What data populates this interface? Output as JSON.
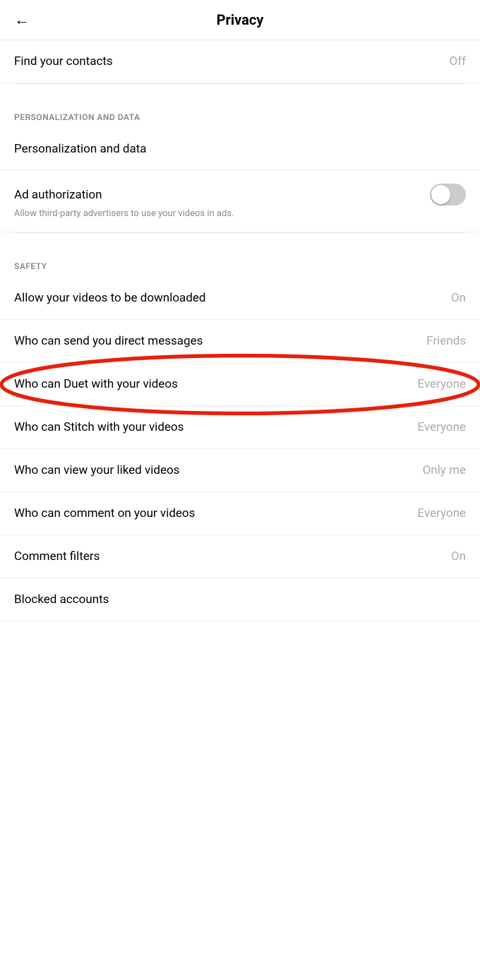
{
  "header": {
    "title": "Privacy",
    "back_label": "←"
  },
  "settings": {
    "find_contacts": {
      "label": "Find your contacts",
      "value": "Off"
    },
    "sections": [
      {
        "id": "personalization",
        "header": "PERSONALIZATION AND DATA",
        "items": [
          {
            "id": "personalization-data",
            "label": "Personalization and data",
            "value": null,
            "toggle": null
          },
          {
            "id": "ad-authorization",
            "label": "Ad authorization",
            "subtitle": "Allow third-party advertisers to use your videos in ads.",
            "toggle": "off"
          }
        ]
      },
      {
        "id": "safety",
        "header": "SAFETY",
        "items": [
          {
            "id": "allow-downloads",
            "label": "Allow your videos to be downloaded",
            "value": "On"
          },
          {
            "id": "direct-messages",
            "label": "Who can send you direct messages",
            "value": "Friends"
          },
          {
            "id": "duet",
            "label": "Who can Duet with your videos",
            "value": "Everyone",
            "highlighted": true
          },
          {
            "id": "stitch",
            "label": "Who can Stitch with your videos",
            "value": "Everyone"
          },
          {
            "id": "liked-videos",
            "label": "Who can view your liked videos",
            "value": "Only me"
          },
          {
            "id": "comment",
            "label": "Who can comment on your videos",
            "value": "Everyone"
          },
          {
            "id": "comment-filters",
            "label": "Comment filters",
            "value": "On"
          },
          {
            "id": "blocked-accounts",
            "label": "Blocked accounts",
            "value": null
          }
        ]
      }
    ]
  }
}
